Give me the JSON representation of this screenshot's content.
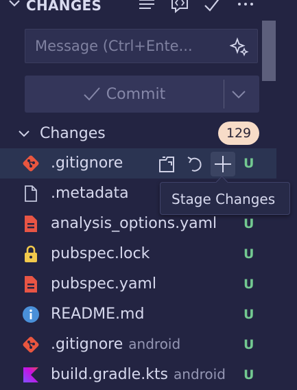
{
  "header": {
    "title": "CHANGES",
    "icons": [
      "collapse-chevron-icon",
      "view-as-tree-icon",
      "code-review-icon",
      "commit-check-icon",
      "more-actions-icon"
    ]
  },
  "message": {
    "placeholder": "Message (Ctrl+Ente..."
  },
  "commit": {
    "label": "Commit"
  },
  "section": {
    "label": "Changes",
    "count": "129"
  },
  "row_actions": {
    "tooltip": "Stage Changes"
  },
  "files": [
    {
      "name": ".gitignore",
      "dir": "",
      "status": "U",
      "icon": "git-icon",
      "active": true
    },
    {
      "name": ".metadata",
      "dir": "",
      "status": "",
      "icon": "file-icon"
    },
    {
      "name": "analysis_options.yaml",
      "dir": "",
      "status": "U",
      "icon": "yaml-icon"
    },
    {
      "name": "pubspec.lock",
      "dir": "",
      "status": "U",
      "icon": "lock-icon"
    },
    {
      "name": "pubspec.yaml",
      "dir": "",
      "status": "U",
      "icon": "yaml-icon"
    },
    {
      "name": "README.md",
      "dir": "",
      "status": "U",
      "icon": "info-icon"
    },
    {
      "name": ".gitignore",
      "dir": "android",
      "status": "U",
      "icon": "git-icon"
    },
    {
      "name": "build.gradle.kts",
      "dir": "android",
      "status": "U",
      "icon": "kotlin-icon"
    }
  ],
  "colors": {
    "background": "#232442",
    "active_row": "#2b3452",
    "untracked": "#73c991",
    "badge": "#f7dcc8"
  }
}
